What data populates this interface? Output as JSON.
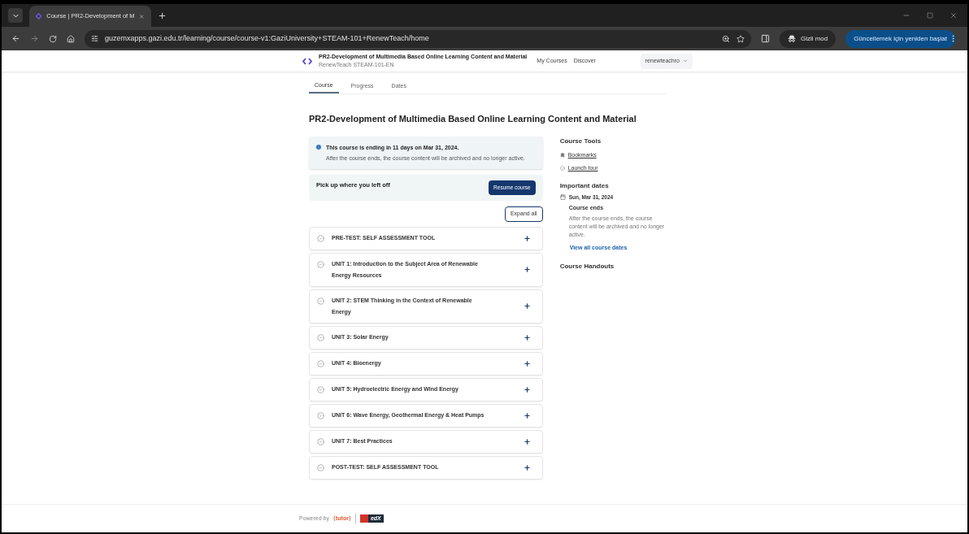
{
  "browser": {
    "tab_title": "Course | PR2-Development of M",
    "url": "guzemxapps.gazi.edu.tr/learning/course/course-v1:GaziUniversity+STEAM-101+RenewTeach/home",
    "incognito_label": "Gizli mod",
    "update_button": "Güncellemek için yeniden başlat"
  },
  "header": {
    "course_title": "PR2-Development of Multimedia Based Online Learning Content and Material",
    "course_code": "RenewTeach STEAM-101-EN",
    "nav": [
      "My Courses",
      "Discover"
    ],
    "user_menu": "renewteachro"
  },
  "tabs": [
    {
      "label": "Course",
      "selected": true
    },
    {
      "label": "Progress",
      "selected": false
    },
    {
      "label": "Dates",
      "selected": false
    }
  ],
  "page_title": "PR2-Development of Multimedia Based Online Learning Content and Material",
  "alert": {
    "title": "This course is ending in 11 days on Mar 31, 2024.",
    "body": "After the course ends, the course content will be archived and no longer active."
  },
  "resume": {
    "text": "Pick up where you left off",
    "button": "Resume course"
  },
  "expand_all": "Expand all",
  "sections": [
    {
      "title": "PRE-TEST: SELF ASSESSMENT TOOL",
      "completed": false
    },
    {
      "title": "UNIT 1: Introduction to the Subject Area of Renewable Energy Resources",
      "completed": false
    },
    {
      "title": "UNIT 2: STEM Thinking in the Context of Renewable Energy",
      "completed": false
    },
    {
      "title": "UNIT 3: Solar Energy",
      "completed": false
    },
    {
      "title": "UNIT 4: Bioenergy",
      "completed": false
    },
    {
      "title": "UNIT 5: Hydroelectric Energy and Wind Energy",
      "completed": false
    },
    {
      "title": "UNIT 6: Wave Energy, Geothermal Energy & Heat Pumps",
      "completed": false
    },
    {
      "title": "UNIT 7: Best Practices",
      "completed": false
    },
    {
      "title": "POST-TEST: SELF ASSESSMENT TOOL",
      "completed": false
    }
  ],
  "sidebar": {
    "tools_heading": "Course Tools",
    "tools": [
      "Bookmarks",
      "Launch tour"
    ],
    "dates_heading": "Important dates",
    "date": "Sun, Mar 31, 2024",
    "date_title": "Course ends",
    "date_body": "After the course ends, the course content will be archived and no longer active.",
    "all_dates_link": "View all course dates",
    "handouts_heading": "Course Handouts"
  },
  "footer": {
    "powered_by": "Powered by",
    "tutor_logo": "⟨tutor⟩",
    "openedx_logo": "edX"
  }
}
